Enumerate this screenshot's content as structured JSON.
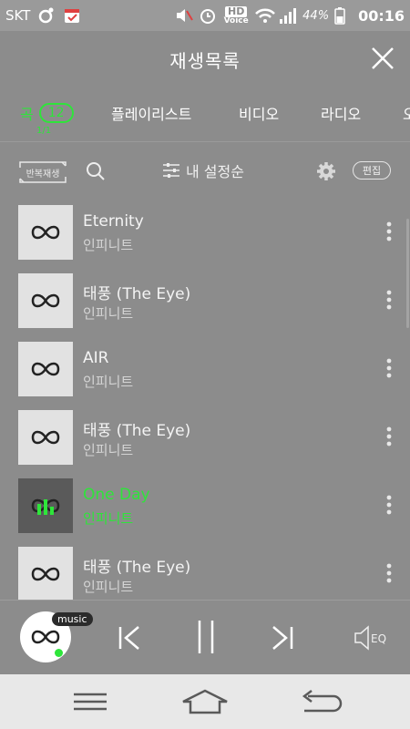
{
  "status_bar": {
    "carrier": "SKT",
    "hd_label": "HD",
    "voice_label": "Voice",
    "battery": "44%",
    "time": "00:16"
  },
  "header": {
    "title": "재생목록"
  },
  "tabs": [
    {
      "label": "곡",
      "count": "12",
      "sub": "1/1"
    },
    {
      "label": "플레이리스트"
    },
    {
      "label": "비디오"
    },
    {
      "label": "라디오"
    },
    {
      "label": "오"
    }
  ],
  "toolbar": {
    "repeat_label": "반복재생",
    "sort_label": "내 설정순",
    "edit_label": "편집"
  },
  "songs": [
    {
      "title": "Eternity",
      "artist": "인피니트",
      "active": false
    },
    {
      "title": "태풍 (The Eye)",
      "artist": "인피니트",
      "active": false
    },
    {
      "title": "AIR",
      "artist": "인피니트",
      "active": false
    },
    {
      "title": "태풍 (The Eye)",
      "artist": "인피니트",
      "active": false
    },
    {
      "title": "One Day",
      "artist": "인피니트",
      "active": true
    },
    {
      "title": "태풍 (The Eye)",
      "artist": "인피니트",
      "active": false
    }
  ],
  "player": {
    "badge": "music",
    "eq_label": "EQ"
  },
  "colors": {
    "accent": "#2ee53a",
    "background": "#8c8c8c",
    "navbar": "#e8e8e8"
  }
}
